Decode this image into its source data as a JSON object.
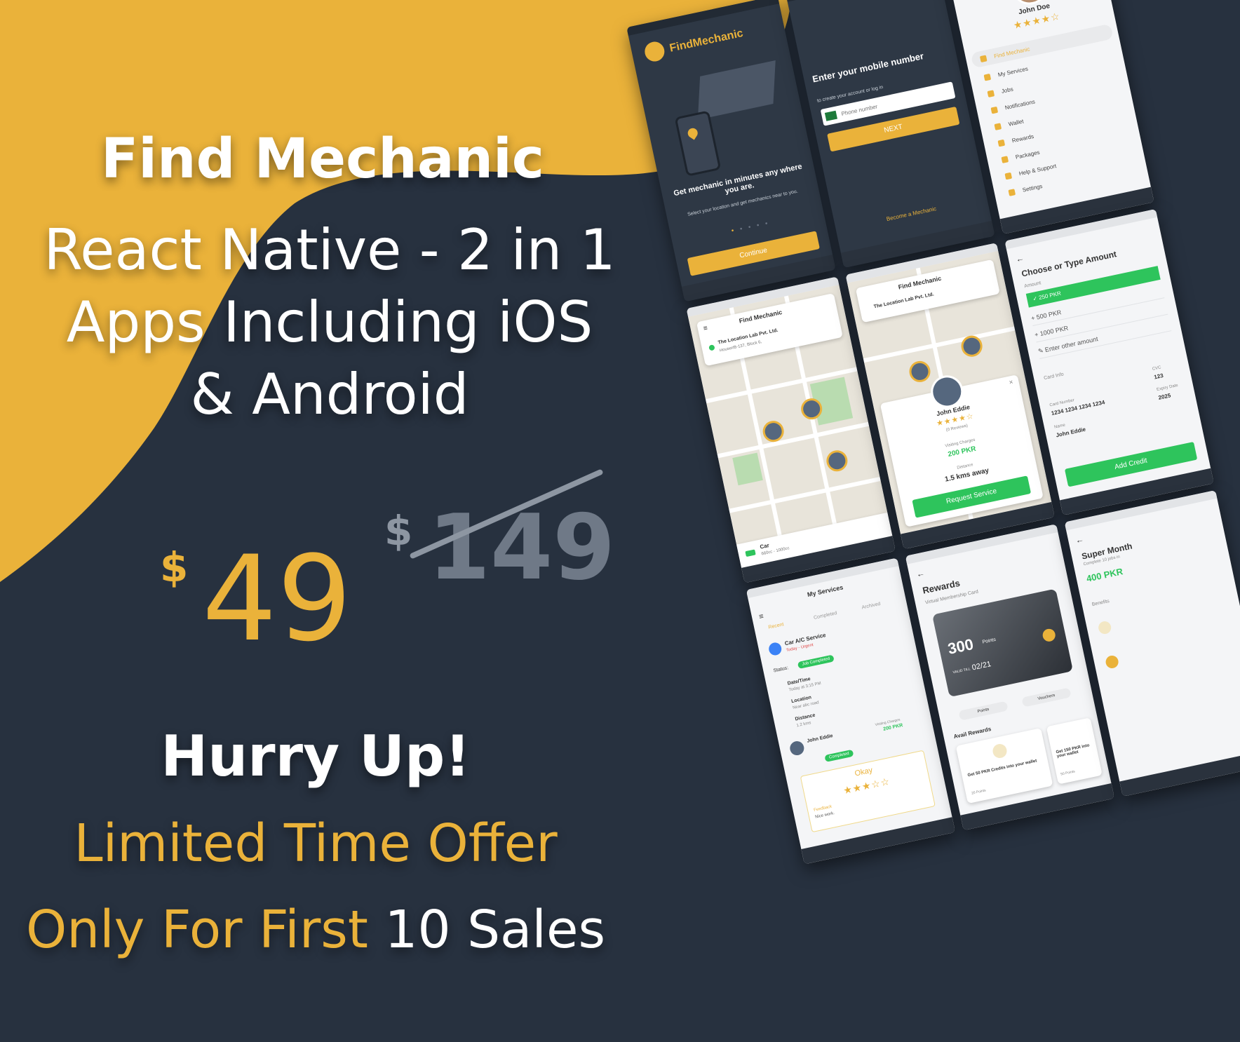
{
  "title": "Find Mechanic",
  "subtitle_lines": [
    "React Native - 2 in 1",
    "Apps Including iOS",
    "& Android"
  ],
  "price": {
    "currency": "$",
    "new": "49",
    "old": "149"
  },
  "hurry": "Hurry Up!",
  "offer": "Limited Time Offer",
  "first_prefix": "Only For First",
  "first_highlight": "10 Sales",
  "colors": {
    "background": "#27313f",
    "accent": "#eab23a",
    "green": "#2ec45c"
  },
  "screens": {
    "splash": {
      "brand": "FindMechanic",
      "headline": "Get mechanic in minutes any where you are.",
      "sub": "Select your location and get mechanics near to you.",
      "button": "Continue"
    },
    "login": {
      "headline": "Enter your mobile number",
      "sub": "to create your account or log in",
      "placeholder": "Phone number",
      "button": "NEXT",
      "link": "Become a Mechanic"
    },
    "menu": {
      "name": "John Doe",
      "items": [
        "Find Mechanic",
        "My Services",
        "Jobs",
        "Notifications",
        "Wallet",
        "Rewards",
        "Packages",
        "Help & Support",
        "Settings"
      ]
    },
    "map": {
      "header": "Find Mechanic",
      "location": "The Location Lab Pvt. Ltd.",
      "address": "House#B-137, Block 6,",
      "vehicle": "Car",
      "vehicle_sub": "660cc - 1000cc"
    },
    "detail": {
      "header": "Find Mechanic",
      "location": "The Location Lab Pvt. Ltd.",
      "name": "John Eddie",
      "reviews": "(0 Reviews)",
      "charges_label": "Visiting Charges",
      "charges": "200 PKR",
      "distance_label": "Distance",
      "distance": "1.5 kms away",
      "button": "Request Service"
    },
    "amount": {
      "title": "Choose or Type Amount",
      "amount_label": "Amount",
      "options": [
        "250 PKR",
        "500 PKR",
        "1000 PKR",
        "Enter other amount"
      ],
      "card_info": "Card Info",
      "card_number_label": "Card Number",
      "card_number": "1234 1234 1234 1234",
      "cvc_label": "CVC",
      "cvc": "123",
      "expiry_label": "Expiry Date",
      "expiry": "2025",
      "name_label": "Name",
      "name": "John Eddie",
      "button": "Add Credit"
    },
    "services": {
      "title": "My Services",
      "tabs": [
        "Recent",
        "Completed",
        "Archived"
      ],
      "service": "Car A/C Service",
      "when": "Today - Urgent",
      "status_label": "Status:",
      "status": "Job Completed",
      "datetime_label": "Date/Time",
      "datetime": "Today at 3:15 PM",
      "location_label": "Location",
      "location": "Near abc road",
      "distance_label": "Distance",
      "distance": "1.2 kms",
      "mechanic": "John Eddie",
      "charges_label": "Visiting Charges",
      "charges": "200 PKR",
      "completed": "Completed",
      "rating_word": "Okay",
      "feedback_label": "Feedback",
      "feedback": "Nice work."
    },
    "rewards": {
      "title": "Rewards",
      "sub": "Virtual Membership Card",
      "points_value": "300",
      "points_word": "Points",
      "valid_label": "VALID TILL",
      "valid": "02/21",
      "tab_points": "Points",
      "tab_vouchers": "Vouchers",
      "avail": "Avail Rewards",
      "reward1": "Get 50 PKR Credits into your wallet",
      "reward1_pts": "20 Points",
      "reward2": "Get 150 PKR into your wallet",
      "reward2_pts": "50 Points"
    },
    "package": {
      "title": "Super Month",
      "sub": "Complete 10 jobs in",
      "price": "400 PKR",
      "benefits": "Benefits"
    }
  }
}
